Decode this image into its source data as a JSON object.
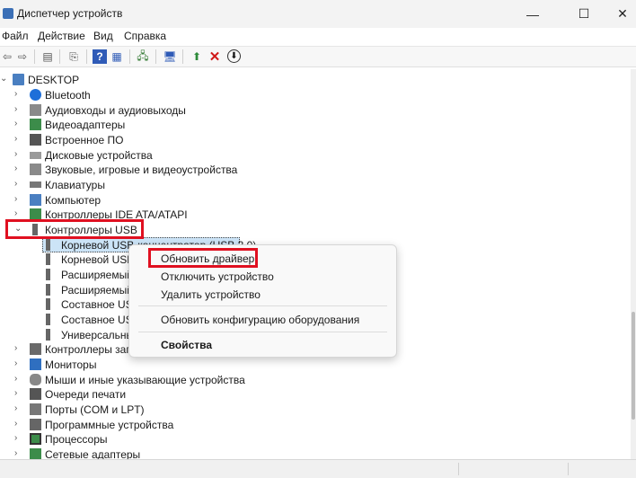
{
  "window": {
    "title": "Диспетчер устройств",
    "minimize": "—",
    "maximize": "☐",
    "close": "✕"
  },
  "menu": [
    "Файл",
    "Действие",
    "Вид",
    "Справка"
  ],
  "toolbar": {
    "back": "⇦",
    "forward": "⇨",
    "properties": "▤",
    "refresh": "⎘",
    "help": "?",
    "view": "▦",
    "scan": "🖧",
    "monitor": "🖥",
    "update": "⬆",
    "remove": "✕",
    "download": "⬇"
  },
  "tree": {
    "root": "DESKTOP",
    "categories_top": [
      {
        "label": "Bluetooth",
        "icon": "bluetooth-icon"
      },
      {
        "label": "Аудиовходы и аудиовыходы",
        "icon": "speaker-icon"
      },
      {
        "label": "Видеоадаптеры",
        "icon": "display-adapter-icon"
      },
      {
        "label": "Встроенное ПО",
        "icon": "firmware-icon"
      },
      {
        "label": "Дисковые устройства",
        "icon": "disk-icon"
      },
      {
        "label": "Звуковые, игровые и видеоустройства",
        "icon": "sound-icon"
      },
      {
        "label": "Клавиатуры",
        "icon": "keyboard-icon"
      },
      {
        "label": "Компьютер",
        "icon": "computer-icon"
      },
      {
        "label": "Контроллеры IDE ATA/ATAPI",
        "icon": "ide-icon"
      }
    ],
    "usb_category": "Контроллеры USB",
    "usb_children": [
      "Корневой USB-концентратор (USB 3.0)",
      "Корневой USB-",
      "Расширяемый",
      "Расширяемый",
      "Составное USB",
      "Составное USB",
      "Универсальны"
    ],
    "categories_bottom": [
      {
        "label": "Контроллеры запо",
        "icon": "storage-controller-icon"
      },
      {
        "label": "Мониторы",
        "icon": "monitor-icon"
      },
      {
        "label": "Мыши и иные указывающие устройства",
        "icon": "mouse-icon"
      },
      {
        "label": "Очереди печати",
        "icon": "printer-icon"
      },
      {
        "label": "Порты (COM и LPT)",
        "icon": "port-icon"
      },
      {
        "label": "Программные устройства",
        "icon": "software-device-icon"
      },
      {
        "label": "Процессоры",
        "icon": "processor-icon"
      },
      {
        "label": "Сетевые адаптеры",
        "icon": "network-adapter-icon"
      }
    ]
  },
  "context_menu": {
    "update_driver": "Обновить драйвер",
    "disable_device": "Отключить устройство",
    "uninstall_device": "Удалить устройство",
    "scan_hardware": "Обновить конфигурацию оборудования",
    "properties": "Свойства"
  },
  "colors": {
    "highlight": "#e01020",
    "selection": "#cce4f7"
  }
}
